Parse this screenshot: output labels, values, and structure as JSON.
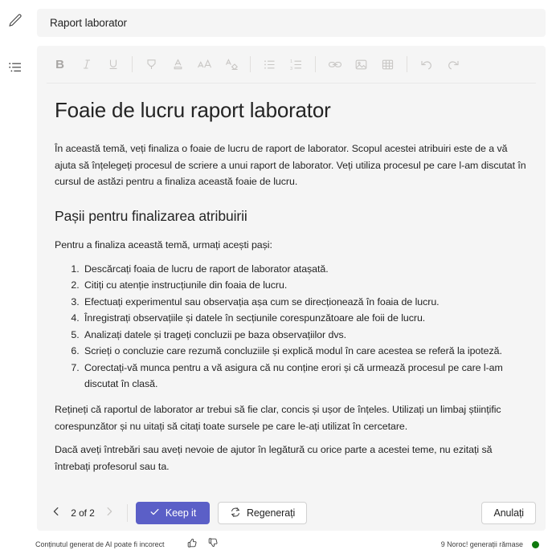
{
  "rail": {
    "items": [
      {
        "icon": "pencil-edit-icon",
        "name": "edit"
      },
      {
        "icon": "list-outline-icon",
        "name": "outline"
      }
    ]
  },
  "title_field": {
    "value": "Raport laborator",
    "placeholder": "Raport laborator"
  },
  "toolbar": {
    "groups": [
      [
        {
          "name": "bold-icon",
          "label": "B"
        },
        {
          "name": "italic-icon",
          "label": "I"
        },
        {
          "name": "underline-icon",
          "label": "U"
        }
      ],
      [
        {
          "name": "highlight-icon",
          "label": "Highlight"
        },
        {
          "name": "font-color-icon",
          "label": "Font color"
        },
        {
          "name": "font-size-icon",
          "label": "Font size"
        },
        {
          "name": "clear-formatting-icon",
          "label": "Clear formatting"
        }
      ],
      [
        {
          "name": "bullet-list-icon",
          "label": "Bulleted list"
        },
        {
          "name": "numbered-list-icon",
          "label": "Numbered list"
        }
      ],
      [
        {
          "name": "link-icon",
          "label": "Insert link"
        },
        {
          "name": "image-icon",
          "label": "Insert image"
        },
        {
          "name": "table-icon",
          "label": "Insert table"
        }
      ],
      [
        {
          "name": "undo-icon",
          "label": "Undo"
        },
        {
          "name": "redo-icon",
          "label": "Redo"
        }
      ]
    ]
  },
  "document": {
    "heading": "Foaie de lucru raport laborator",
    "intro": "În această temă, veți finaliza o foaie de lucru de raport de laborator. Scopul acestei atribuiri este de a vă ajuta să înțelegeți procesul de scriere a unui raport de laborator. Veți utiliza procesul pe care l-am discutat în cursul de astăzi pentru a finaliza această foaie de lucru.",
    "subheading": "Pașii pentru finalizarea atribuirii",
    "steps_intro": "Pentru a finaliza această temă, urmați acești pași:",
    "steps": [
      "Descărcați foaia de lucru de raport de laborator atașată.",
      "Citiți cu atenție instrucțiunile din foaia de lucru.",
      "Efectuați experimentul sau observația așa cum se direcționează în foaia de lucru.",
      "Înregistrați observațiile și datele în secțiunile corespunzătoare ale foii de lucru.",
      "Analizați datele și trageți concluzii pe baza observațiilor dvs.",
      "Scrieți o concluzie care rezumă concluziile și explică modul în care acestea se referă la ipoteză.",
      "Corectați-vă munca pentru a vă asigura că nu conține erori și că urmează procesul pe care l-am discutat în clasă."
    ],
    "closing_1": "Rețineți că raportul de laborator ar trebui să fie clar, concis și ușor de înțeles. Utilizați un limbaj științific corespunzător și nu uitați să citați toate sursele pe care le-ați utilizat în cercetare.",
    "closing_2": "Dacă aveți întrebări sau aveți nevoie de ajutor în legătură cu orice parte a acestei teme, nu ezitați să întrebați profesorul sau ta."
  },
  "actions": {
    "pager_label": "2 of 2",
    "prev_icon": "chevron-left-icon",
    "next_icon": "chevron-right-icon",
    "keep_label": "Keep it",
    "keep_icon": "checkmark-icon",
    "regenerate_label": "Regenerați",
    "regenerate_icon": "refresh-circular-arrows-icon",
    "cancel_label": "Anulați"
  },
  "footer": {
    "ai_notice": "Conținutul generat de AI poate fi incorect",
    "thumbs_up_icon": "thumbs-up-icon",
    "thumbs_down_icon": "thumbs-down-icon",
    "quota_text": "9 Noroc! generații rămase",
    "status_color": "#0e7a0d"
  },
  "colors": {
    "accent": "#5b5fc7",
    "field_bg": "#f5f5f5",
    "text": "#242424",
    "muted_icon": "#c8c6c4"
  }
}
